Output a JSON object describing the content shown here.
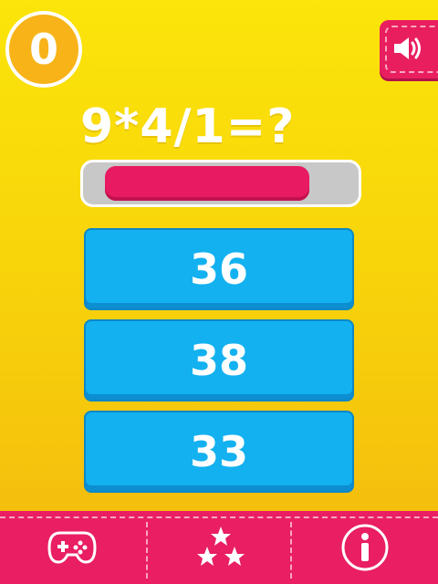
{
  "score": "0",
  "question": "9*4/1=?",
  "timer": {
    "remaining_fraction": 0.88,
    "fill_color": "#e81a62",
    "track_color": "#c8c8c8"
  },
  "answers": [
    "36",
    "38",
    "33"
  ],
  "colors": {
    "background_top": "#fbe50a",
    "background_bottom": "#f4b80e",
    "score_badge": "#f8b318",
    "answer_button": "#13b1f0",
    "bottom_bar": "#e91e63"
  },
  "icons": {
    "sound": "speaker-icon",
    "nav": [
      "gamepad-icon",
      "stars-icon",
      "info-icon"
    ]
  }
}
